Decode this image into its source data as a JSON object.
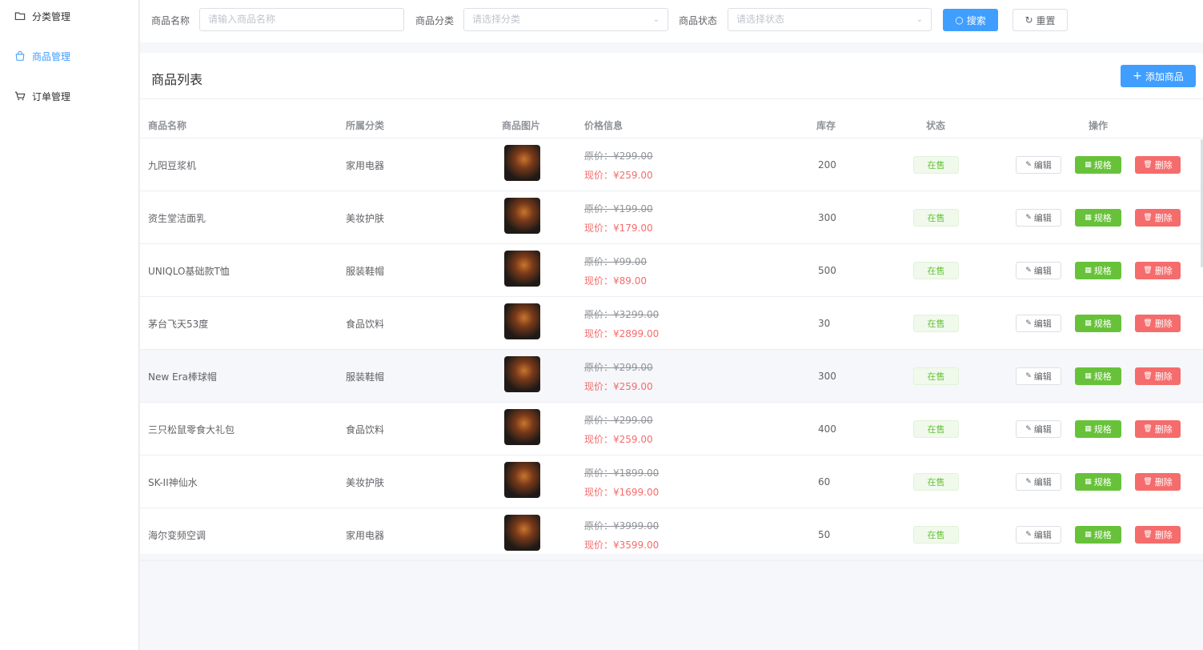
{
  "sidebar": {
    "items": [
      {
        "label": "分类管理",
        "icon": "folder-icon"
      },
      {
        "label": "商品管理",
        "icon": "shopping-bag-icon",
        "active": true
      },
      {
        "label": "订单管理",
        "icon": "cart-icon"
      }
    ]
  },
  "search": {
    "name_label": "商品名称",
    "name_placeholder": "请输入商品名称",
    "category_label": "商品分类",
    "category_placeholder": "请选择分类",
    "status_label": "商品状态",
    "status_placeholder": "请选择状态",
    "search_button": "搜索",
    "reset_button": "重置"
  },
  "list": {
    "title": "商品列表",
    "add_button": "添加商品",
    "columns": [
      "商品名称",
      "所属分类",
      "商品图片",
      "价格信息",
      "库存",
      "状态",
      "操作"
    ],
    "edit_label": "编辑",
    "spec_label": "规格",
    "delete_label": "删除",
    "rows": [
      {
        "name": "九阳豆浆机",
        "category": "家用电器",
        "orig": "原价：¥299.00",
        "now": "现价：¥259.00",
        "stock": "200",
        "status": "在售"
      },
      {
        "name": "资生堂洁面乳",
        "category": "美妆护肤",
        "orig": "原价：¥199.00",
        "now": "现价：¥179.00",
        "stock": "300",
        "status": "在售"
      },
      {
        "name": "UNIQLO基础款T恤",
        "category": "服装鞋帽",
        "orig": "原价：¥99.00",
        "now": "现价：¥89.00",
        "stock": "500",
        "status": "在售"
      },
      {
        "name": "茅台飞天53度",
        "category": "食品饮料",
        "orig": "原价：¥3299.00",
        "now": "现价：¥2899.00",
        "stock": "30",
        "status": "在售"
      },
      {
        "name": "New Era棒球帽",
        "category": "服装鞋帽",
        "orig": "原价：¥299.00",
        "now": "现价：¥259.00",
        "stock": "300",
        "status": "在售"
      },
      {
        "name": "三只松鼠零食大礼包",
        "category": "食品饮料",
        "orig": "原价：¥299.00",
        "now": "现价：¥259.00",
        "stock": "400",
        "status": "在售"
      },
      {
        "name": "SK-II神仙水",
        "category": "美妆护肤",
        "orig": "原价：¥1899.00",
        "now": "现价：¥1699.00",
        "stock": "60",
        "status": "在售"
      },
      {
        "name": "海尔变频空调",
        "category": "家用电器",
        "orig": "原价：¥3999.00",
        "now": "现价：¥3599.00",
        "stock": "50",
        "status": "在售"
      }
    ]
  }
}
